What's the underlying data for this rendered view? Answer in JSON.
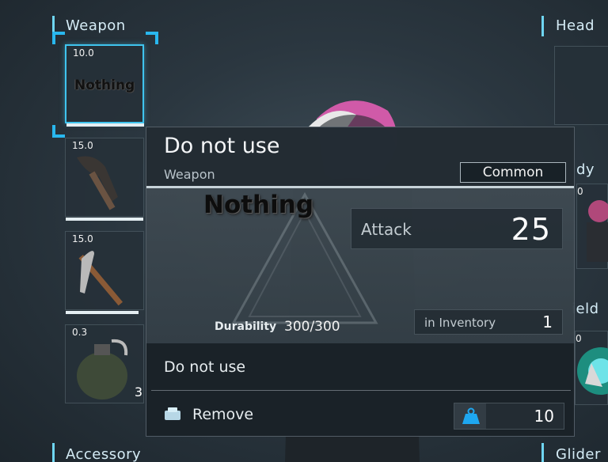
{
  "sections": {
    "weapon": "Weapon",
    "head": "Head",
    "body_partial": "dy",
    "shield_partial": "ield",
    "accessory": "Accessory",
    "glider": "Glider"
  },
  "weapon_slots": [
    {
      "value": "10.0",
      "label": "Nothing",
      "icon": "nothing",
      "selected": true
    },
    {
      "value": "15.0",
      "label": "",
      "icon": "axe-icon"
    },
    {
      "value": "15.0",
      "label": "",
      "icon": "pickaxe-icon"
    },
    {
      "value": "0.3",
      "label": "",
      "icon": "grenade-icon",
      "count": "3"
    }
  ],
  "right_slots": {
    "body_value_partial": "0",
    "shield_value_partial": "0"
  },
  "tooltip": {
    "title": "Do not use",
    "category": "Weapon",
    "rarity": "Common",
    "item_name": "Nothing",
    "attack_label": "Attack",
    "attack_value": "25",
    "durability_label": "Durability",
    "durability_value": "300/300",
    "inventory_label": "in Inventory",
    "inventory_value": "1",
    "description": "Do not use",
    "remove_label": "Remove",
    "weight_value": "10"
  },
  "colors": {
    "accent": "#29b7ee",
    "weight_icon": "#1ea7f0"
  }
}
